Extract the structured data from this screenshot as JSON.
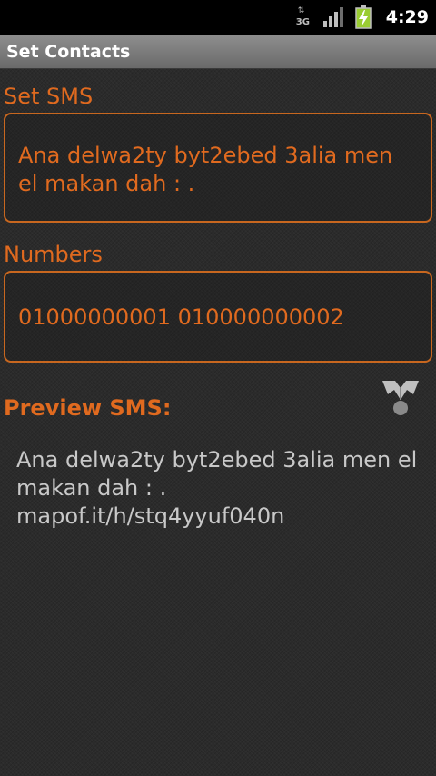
{
  "status_bar": {
    "network_label": "3G",
    "time": "4:29"
  },
  "title_bar": {
    "title": "Set Contacts"
  },
  "sms_section": {
    "label": "Set SMS",
    "value": "Ana delwa2ty byt2ebed 3alia men el makan dah : ."
  },
  "numbers_section": {
    "label": "Numbers",
    "value": "01000000001 010000000002"
  },
  "preview_section": {
    "label": "Preview SMS:",
    "text": "Ana delwa2ty byt2ebed 3alia men el makan dah : . mapof.it/h/stq4yyuf040n",
    "icon": "map-share-icon"
  },
  "colors": {
    "accent": "#e06a1f",
    "background": "#2b2b2b",
    "preview_text": "#c8c8c8"
  }
}
